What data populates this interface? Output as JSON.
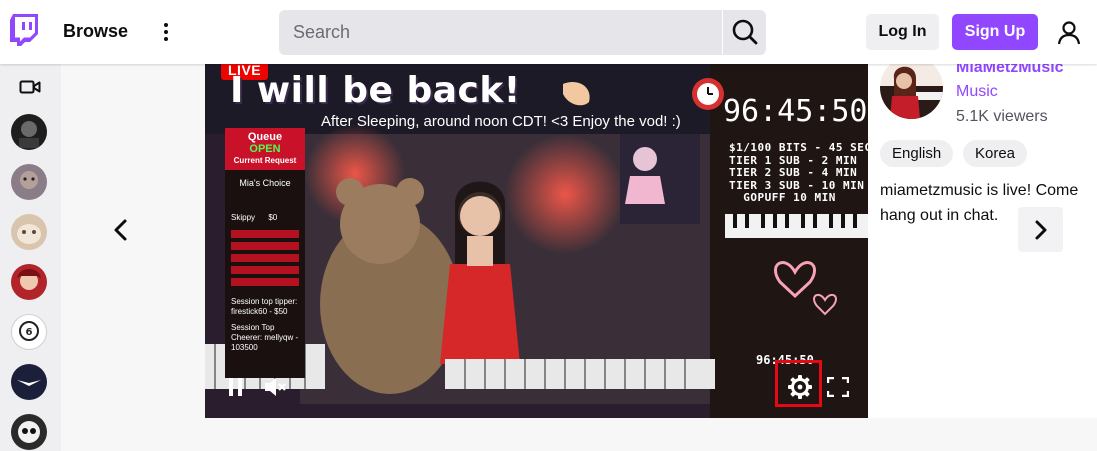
{
  "nav": {
    "browse_label": "Browse",
    "search_placeholder": "Search",
    "login_label": "Log In",
    "signup_label": "Sign Up",
    "brand_color": "#9147ff"
  },
  "sidebar": {
    "avatars": [
      {
        "name": "channel-1",
        "color": "#1e1e1e"
      },
      {
        "name": "channel-2",
        "color": "#7d6f7a"
      },
      {
        "name": "channel-3",
        "color": "#c9a98a"
      },
      {
        "name": "channel-4",
        "color": "#b0242a"
      },
      {
        "name": "channel-5",
        "color": "#ffffff"
      },
      {
        "name": "channel-6",
        "color": "#1b1f3a"
      },
      {
        "name": "channel-7",
        "color": "#2a2a2a"
      }
    ]
  },
  "player": {
    "live_label": "LIVE",
    "overlay_title": "I will be back!",
    "overlay_subtitle": "After Sleeping, around noon CDT! <3 Enjoy the vod! :)",
    "timer": "96:45:50",
    "price_list": "$1/100 BITS - 45 SEC\nTIER 1 SUB - 2 MIN\nTIER 2 SUB - 4 MIN\nTIER 3 SUB - 10 MIN\n  GOPUFF 10 MIN",
    "small_timer": "96:45:50",
    "queue": {
      "title": "Queue",
      "status": "OPEN",
      "current": "Current Request",
      "choice": "Mia's Choice",
      "skippy": "Skippy      $0",
      "top_tipper": "Session top tipper: firestick60 - $50",
      "top_cheerer": "Session Top Cheerer: mellyqw - 103500"
    }
  },
  "channel": {
    "name": "MiaMetzMusic",
    "category": "Music",
    "viewers": "5.1K viewers",
    "tags": [
      "English",
      "Korea"
    ],
    "description": "miametzmusic is live! Come hang out in chat."
  }
}
